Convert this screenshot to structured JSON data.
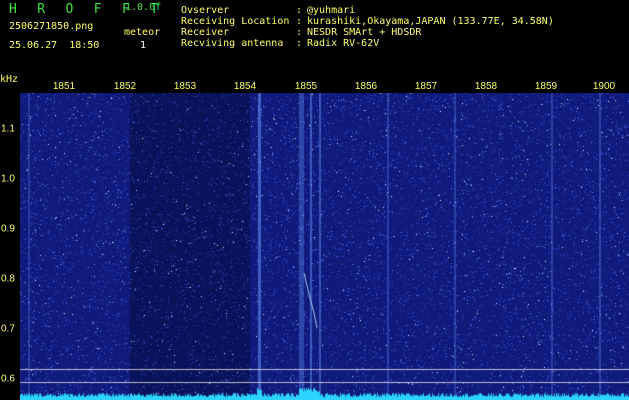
{
  "header": {
    "app_title": "H R O F F T",
    "version": "1.0.0f",
    "filename": "2506271850.png",
    "datetime": "25.06.27  18:50",
    "mode_label": "meteor",
    "mode_value": "1"
  },
  "station_info": [
    {
      "label": "Ovserver",
      "value": "@yuhmari"
    },
    {
      "label": "Receiving Location",
      "value": "kurashiki,Okayama,JAPAN (133.77E, 34.58N)"
    },
    {
      "label": "Receiver",
      "value": "NESDR SMArt + HDSDR"
    },
    {
      "label": "Recviving antenna",
      "value": "Radix RV-62V"
    }
  ],
  "spectrogram": {
    "y_unit": "kHz",
    "time_ticks": [
      "1851",
      "1852",
      "1853",
      "1854",
      "1855",
      "1856",
      "1857",
      "1858",
      "1859",
      "1900"
    ],
    "freq_ticks": [
      "1.1",
      "1.0",
      "0.9",
      "0.8",
      "0.7",
      "0.6"
    ],
    "freq_range_khz": [
      0.58,
      1.18
    ],
    "time_range_min": [
      1850.4,
      1900.2
    ],
    "colors": {
      "background": "#0f1a7a",
      "noise": "#3a52d8",
      "signal": "#bfe6ff",
      "spectrum": "#2ad4ff",
      "ticks": "#ffff66"
    }
  }
}
